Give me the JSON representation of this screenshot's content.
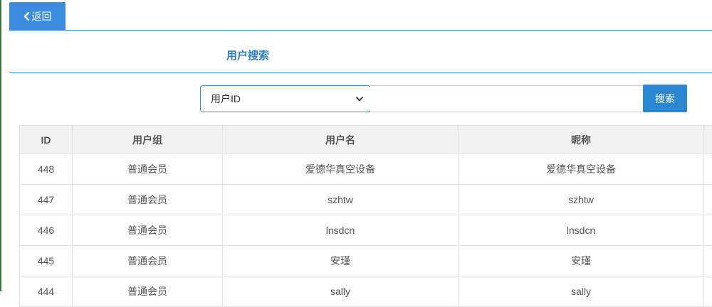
{
  "nav": {
    "back_label": "返回"
  },
  "page": {
    "title": "用户搜索"
  },
  "search": {
    "field_selected": "用户ID",
    "input_value": "",
    "button_label": "搜索"
  },
  "table": {
    "headers": [
      "ID",
      "用户组",
      "用户名",
      "昵称",
      ""
    ],
    "rows": [
      {
        "id": "448",
        "group": "普通会员",
        "username": "爱德华真空设备",
        "nickname": "爱德华真空设备"
      },
      {
        "id": "447",
        "group": "普通会员",
        "username": "szhtw",
        "nickname": "szhtw"
      },
      {
        "id": "446",
        "group": "普通会员",
        "username": "lnsdcn",
        "nickname": "lnsdcn"
      },
      {
        "id": "445",
        "group": "普通会员",
        "username": "安瑾",
        "nickname": "安瑾"
      },
      {
        "id": "444",
        "group": "普通会员",
        "username": "sally",
        "nickname": "sally"
      }
    ]
  },
  "colors": {
    "accent": "#3b8de0",
    "button": "#2a87d0",
    "title": "#2f7fc6"
  }
}
